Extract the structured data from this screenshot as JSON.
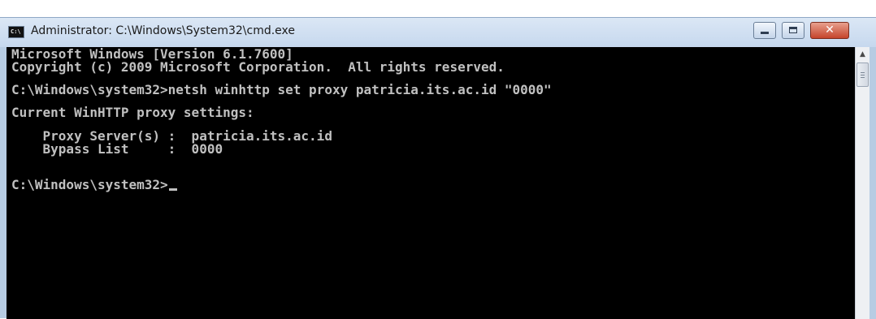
{
  "window": {
    "title": "Administrator: C:\\Windows\\System32\\cmd.exe",
    "app_icon_text": "C:\\",
    "icon": "cmd-icon",
    "close_label": "✕"
  },
  "console": {
    "lines": [
      "Microsoft Windows [Version 6.1.7600]",
      "Copyright (c) 2009 Microsoft Corporation.  All rights reserved.",
      "",
      "C:\\Windows\\system32>netsh winhttp set proxy patricia.its.ac.id \"0000\"",
      "",
      "Current WinHTTP proxy settings:",
      "",
      "    Proxy Server(s) :  patricia.its.ac.id",
      "    Bypass List     :  0000",
      "",
      "",
      "C:\\Windows\\system32>"
    ]
  },
  "colors": {
    "console_background": "#000000",
    "console_text": "#c0c0c0",
    "titlebar": "#c6d8ee"
  }
}
